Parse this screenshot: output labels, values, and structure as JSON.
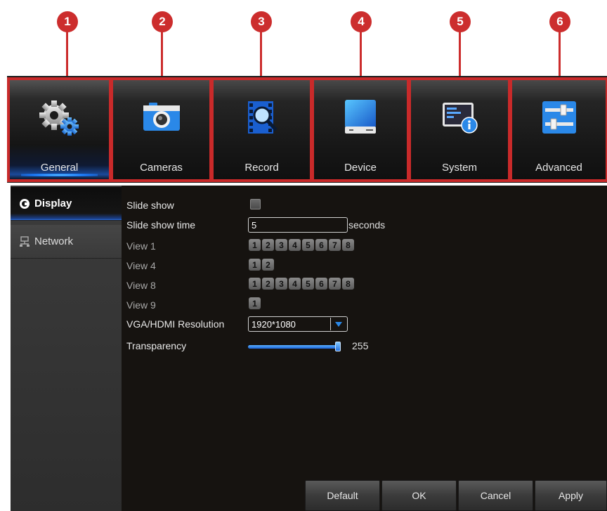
{
  "callouts": [
    "1",
    "2",
    "3",
    "4",
    "5",
    "6"
  ],
  "tabs": [
    {
      "label": "General",
      "icon": "gears-icon"
    },
    {
      "label": "Cameras",
      "icon": "camera-icon"
    },
    {
      "label": "Record",
      "icon": "film-search-icon"
    },
    {
      "label": "Device",
      "icon": "hard-drive-icon"
    },
    {
      "label": "System",
      "icon": "system-info-icon"
    },
    {
      "label": "Advanced",
      "icon": "sliders-icon"
    }
  ],
  "sidebar": {
    "items": [
      {
        "label": "Display",
        "icon": "display-circle-icon",
        "active": true
      },
      {
        "label": "Network",
        "icon": "network-icon",
        "active": false
      }
    ]
  },
  "display": {
    "slide_show_label": "Slide show",
    "slide_show_checked": false,
    "slide_show_time_label": "Slide show time",
    "slide_show_time_value": "5",
    "slide_show_time_unit": "seconds",
    "view1_label": "View 1",
    "view1_channels": [
      "1",
      "2",
      "3",
      "4",
      "5",
      "6",
      "7",
      "8"
    ],
    "view4_label": "View 4",
    "view4_channels": [
      "1",
      "2"
    ],
    "view8_label": "View 8",
    "view8_channels": [
      "1",
      "2",
      "3",
      "4",
      "5",
      "6",
      "7",
      "8"
    ],
    "view9_label": "View 9",
    "view9_channels": [
      "1"
    ],
    "resolution_label": "VGA/HDMI Resolution",
    "resolution_value": "1920*1080",
    "transparency_label": "Transparency",
    "transparency_value": "255",
    "transparency_fraction": 1.0
  },
  "buttons": {
    "default": "Default",
    "ok": "OK",
    "cancel": "Cancel",
    "apply": "Apply"
  },
  "colors": {
    "callout_red": "#cc2d2d",
    "accent_blue": "#1a7cff"
  }
}
